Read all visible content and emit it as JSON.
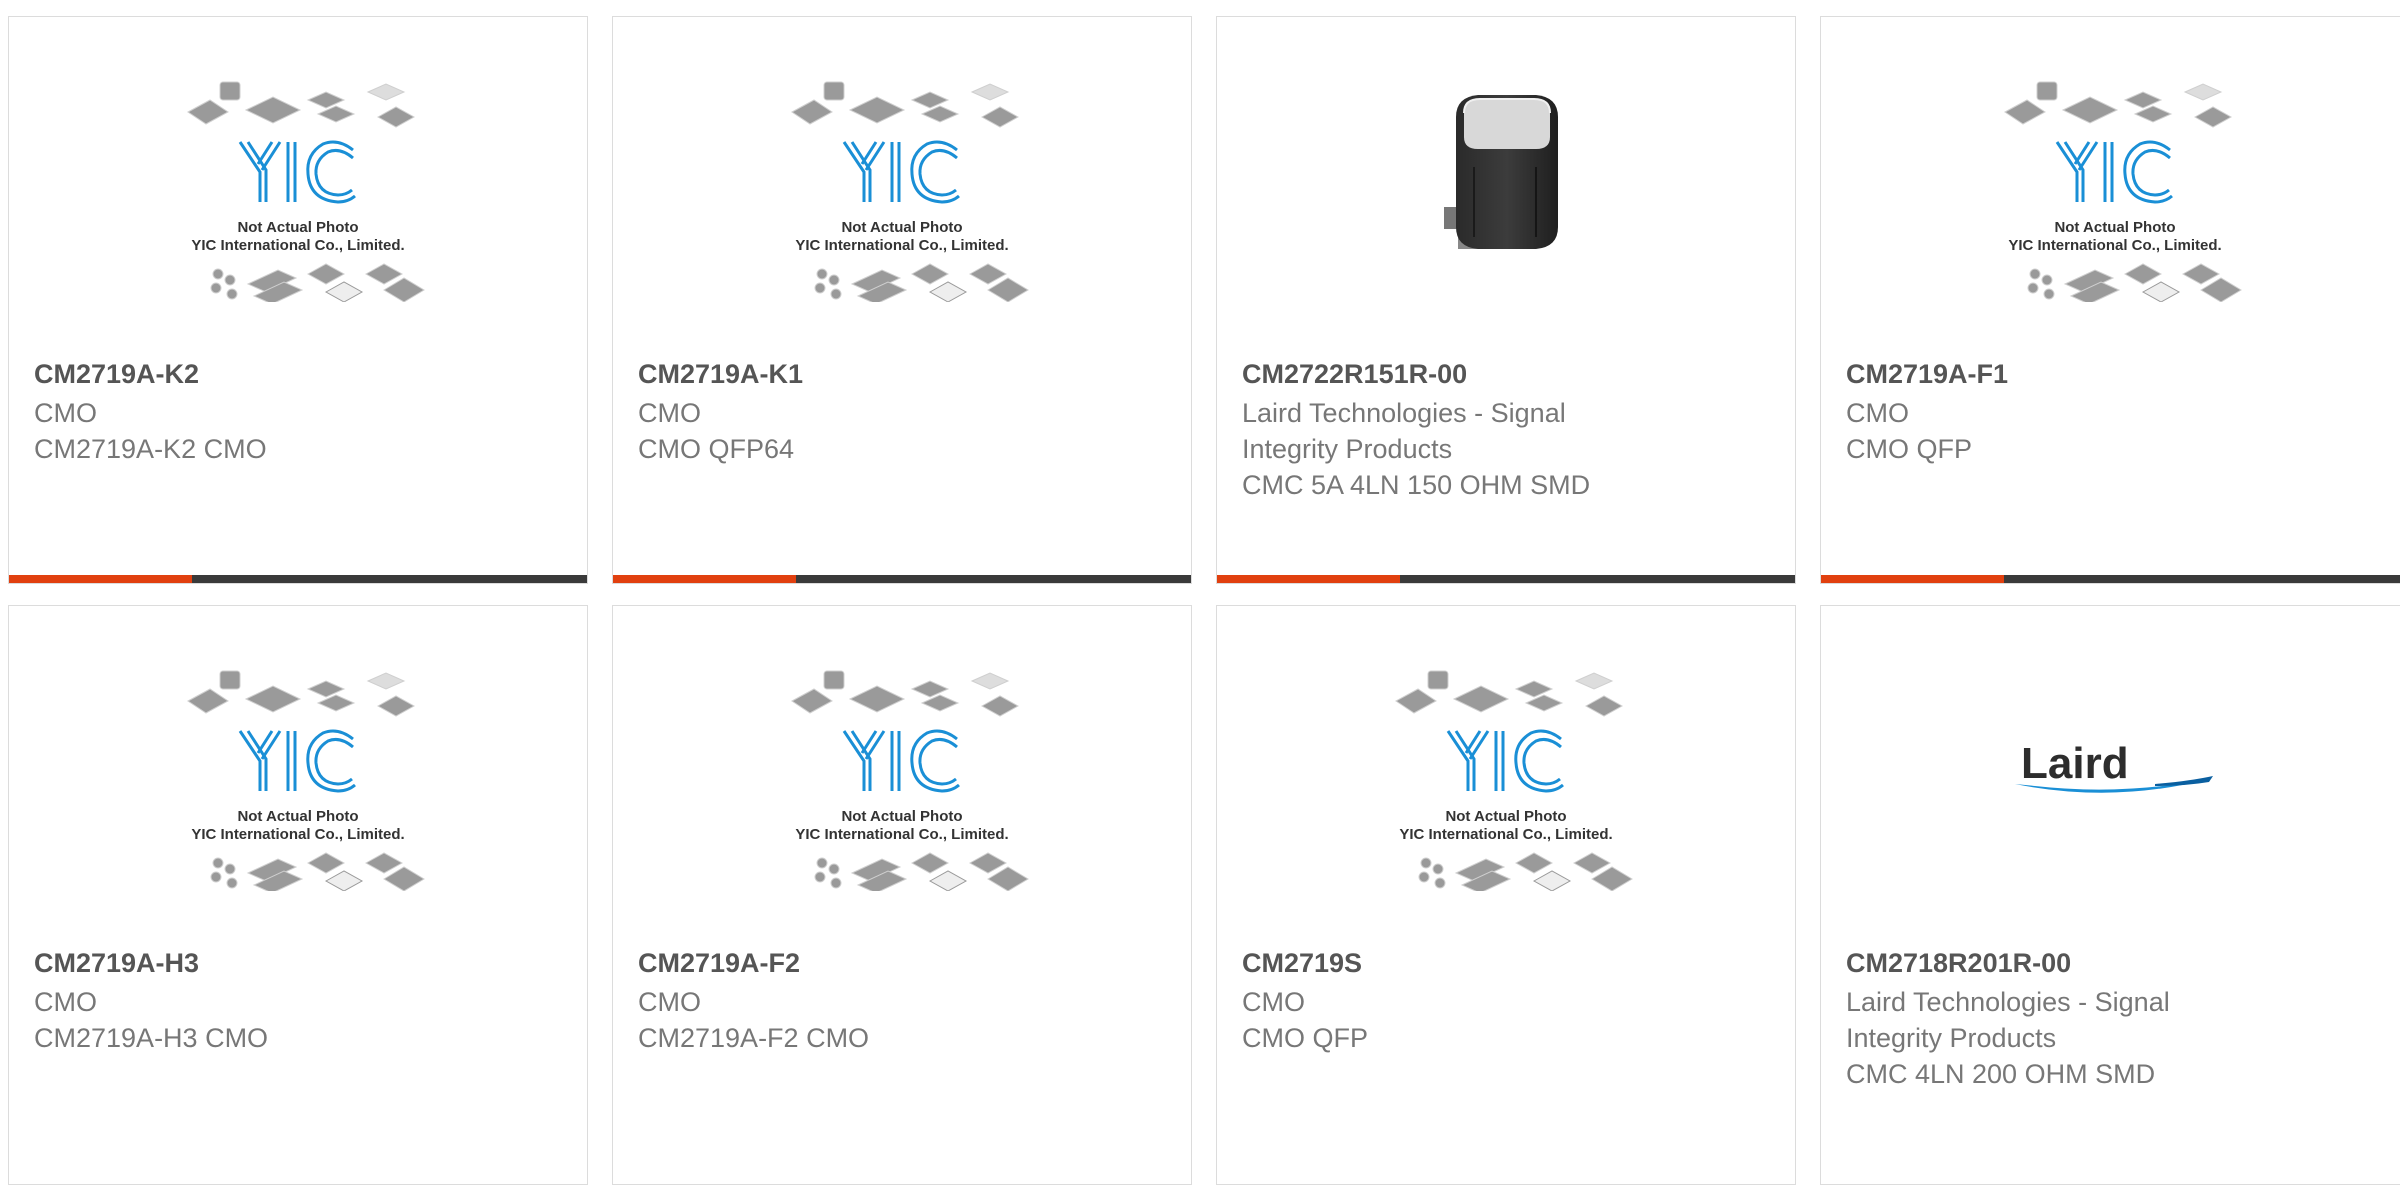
{
  "products": [
    {
      "part_number": "CM2719A-K2",
      "manufacturer": "CMO",
      "description": "CM2719A-K2 CMO",
      "image": "yic-placeholder"
    },
    {
      "part_number": "CM2719A-K1",
      "manufacturer": "CMO",
      "description": "CMO QFP64",
      "image": "yic-placeholder"
    },
    {
      "part_number": "CM2722R151R-00",
      "manufacturer": "Laird Technologies - Signal Integrity Products",
      "description": "CMC 5A 4LN 150 OHM SMD",
      "image": "choke-photo"
    },
    {
      "part_number": "CM2719A-F1",
      "manufacturer": "CMO",
      "description": "CMO QFP",
      "image": "yic-placeholder"
    },
    {
      "part_number": "CM2719A-H3",
      "manufacturer": "CMO",
      "description": "CM2719A-H3 CMO",
      "image": "yic-placeholder"
    },
    {
      "part_number": "CM2719A-F2",
      "manufacturer": "CMO",
      "description": "CM2719A-F2 CMO",
      "image": "yic-placeholder"
    },
    {
      "part_number": "CM2719S",
      "manufacturer": "CMO",
      "description": "CMO QFP",
      "image": "yic-placeholder"
    },
    {
      "part_number": "CM2718R201R-00",
      "manufacturer": "Laird Technologies - Signal Integrity Products",
      "description": "CMC 4LN 200 OHM SMD",
      "image": "laird-logo"
    }
  ],
  "placeholder": {
    "line1": "Not Actual Photo",
    "line2": "YIC International Co., Limited."
  },
  "laird_logo_text": "Laird",
  "colors": {
    "accent": "#e1400f",
    "bar": "#3a3a3a",
    "yic_blue": "#1a8fd6"
  }
}
